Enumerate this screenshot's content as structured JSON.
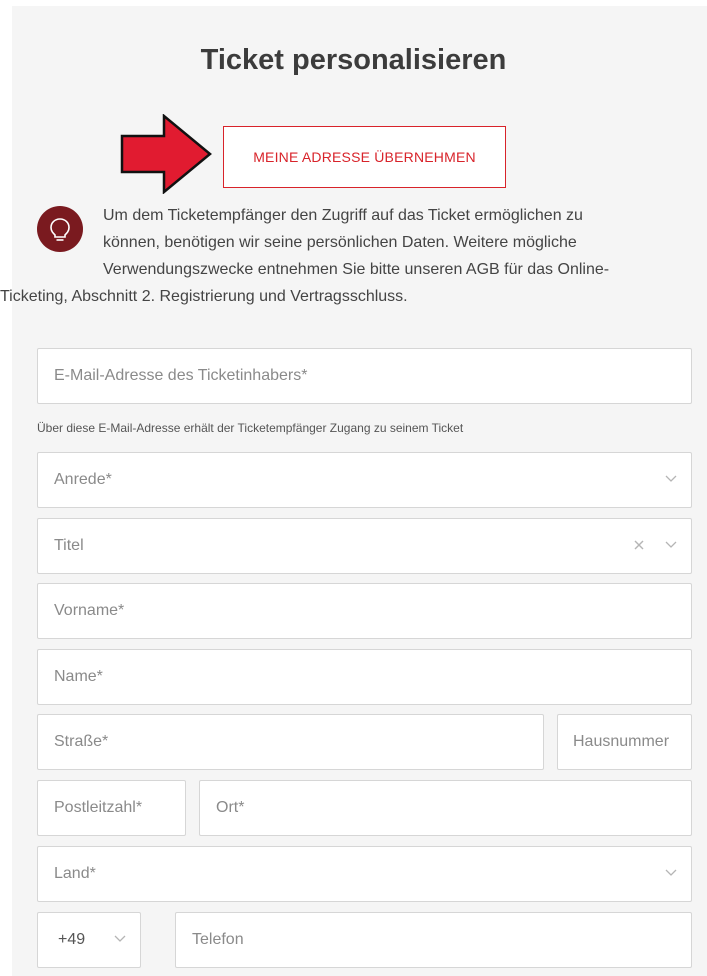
{
  "header": {
    "title": "Ticket personalisieren"
  },
  "actions": {
    "adopt_address_label": "MEINE ADRESSE ÜBERNEHMEN"
  },
  "info": {
    "icon": "lightbulb-icon",
    "lines": [
      "Um dem Ticketempfänger den Zugriff auf das Ticket ermöglichen zu",
      "können, benötigen wir seine persönlichen Daten. Weitere mögliche",
      "Verwendungszwecke entnehmen Sie bitte unseren AGB für das Online-",
      "Ticketing, Abschnitt 2. Registrierung und Vertragsschluss."
    ]
  },
  "form": {
    "email_placeholder": "E-Mail-Adresse des Ticketinhabers*",
    "email_hint": "Über diese E-Mail-Adresse erhält der Ticketempfänger Zugang zu seinem Ticket",
    "salutation_placeholder": "Anrede*",
    "title_placeholder": "Titel",
    "firstname_placeholder": "Vorname*",
    "lastname_placeholder": "Name*",
    "street_placeholder": "Straße*",
    "housenumber_placeholder": "Hausnummer",
    "zip_placeholder": "Postleitzahl*",
    "city_placeholder": "Ort*",
    "country_placeholder": "Land*",
    "phone_prefix": "+49",
    "phone_placeholder": "Telefon"
  },
  "colors": {
    "accent": "#d8232a",
    "icon_bg": "#7a1a1f",
    "panel_bg": "#f5f5f5"
  }
}
